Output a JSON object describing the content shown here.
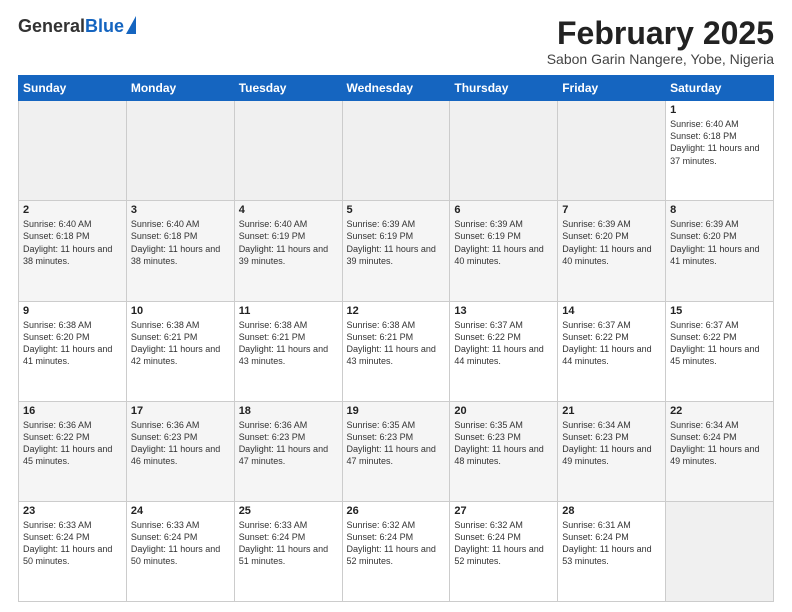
{
  "header": {
    "logo_general": "General",
    "logo_blue": "Blue",
    "month_title": "February 2025",
    "location": "Sabon Garin Nangere, Yobe, Nigeria"
  },
  "days_of_week": [
    "Sunday",
    "Monday",
    "Tuesday",
    "Wednesday",
    "Thursday",
    "Friday",
    "Saturday"
  ],
  "weeks": [
    [
      {
        "day": "",
        "empty": true
      },
      {
        "day": "",
        "empty": true
      },
      {
        "day": "",
        "empty": true
      },
      {
        "day": "",
        "empty": true
      },
      {
        "day": "",
        "empty": true
      },
      {
        "day": "",
        "empty": true
      },
      {
        "day": "1",
        "sunrise": "Sunrise: 6:40 AM",
        "sunset": "Sunset: 6:18 PM",
        "daylight": "Daylight: 11 hours and 37 minutes."
      }
    ],
    [
      {
        "day": "2",
        "sunrise": "Sunrise: 6:40 AM",
        "sunset": "Sunset: 6:18 PM",
        "daylight": "Daylight: 11 hours and 38 minutes."
      },
      {
        "day": "3",
        "sunrise": "Sunrise: 6:40 AM",
        "sunset": "Sunset: 6:18 PM",
        "daylight": "Daylight: 11 hours and 38 minutes."
      },
      {
        "day": "4",
        "sunrise": "Sunrise: 6:40 AM",
        "sunset": "Sunset: 6:19 PM",
        "daylight": "Daylight: 11 hours and 39 minutes."
      },
      {
        "day": "5",
        "sunrise": "Sunrise: 6:39 AM",
        "sunset": "Sunset: 6:19 PM",
        "daylight": "Daylight: 11 hours and 39 minutes."
      },
      {
        "day": "6",
        "sunrise": "Sunrise: 6:39 AM",
        "sunset": "Sunset: 6:19 PM",
        "daylight": "Daylight: 11 hours and 40 minutes."
      },
      {
        "day": "7",
        "sunrise": "Sunrise: 6:39 AM",
        "sunset": "Sunset: 6:20 PM",
        "daylight": "Daylight: 11 hours and 40 minutes."
      },
      {
        "day": "8",
        "sunrise": "Sunrise: 6:39 AM",
        "sunset": "Sunset: 6:20 PM",
        "daylight": "Daylight: 11 hours and 41 minutes."
      }
    ],
    [
      {
        "day": "9",
        "sunrise": "Sunrise: 6:38 AM",
        "sunset": "Sunset: 6:20 PM",
        "daylight": "Daylight: 11 hours and 41 minutes."
      },
      {
        "day": "10",
        "sunrise": "Sunrise: 6:38 AM",
        "sunset": "Sunset: 6:21 PM",
        "daylight": "Daylight: 11 hours and 42 minutes."
      },
      {
        "day": "11",
        "sunrise": "Sunrise: 6:38 AM",
        "sunset": "Sunset: 6:21 PM",
        "daylight": "Daylight: 11 hours and 43 minutes."
      },
      {
        "day": "12",
        "sunrise": "Sunrise: 6:38 AM",
        "sunset": "Sunset: 6:21 PM",
        "daylight": "Daylight: 11 hours and 43 minutes."
      },
      {
        "day": "13",
        "sunrise": "Sunrise: 6:37 AM",
        "sunset": "Sunset: 6:22 PM",
        "daylight": "Daylight: 11 hours and 44 minutes."
      },
      {
        "day": "14",
        "sunrise": "Sunrise: 6:37 AM",
        "sunset": "Sunset: 6:22 PM",
        "daylight": "Daylight: 11 hours and 44 minutes."
      },
      {
        "day": "15",
        "sunrise": "Sunrise: 6:37 AM",
        "sunset": "Sunset: 6:22 PM",
        "daylight": "Daylight: 11 hours and 45 minutes."
      }
    ],
    [
      {
        "day": "16",
        "sunrise": "Sunrise: 6:36 AM",
        "sunset": "Sunset: 6:22 PM",
        "daylight": "Daylight: 11 hours and 45 minutes."
      },
      {
        "day": "17",
        "sunrise": "Sunrise: 6:36 AM",
        "sunset": "Sunset: 6:23 PM",
        "daylight": "Daylight: 11 hours and 46 minutes."
      },
      {
        "day": "18",
        "sunrise": "Sunrise: 6:36 AM",
        "sunset": "Sunset: 6:23 PM",
        "daylight": "Daylight: 11 hours and 47 minutes."
      },
      {
        "day": "19",
        "sunrise": "Sunrise: 6:35 AM",
        "sunset": "Sunset: 6:23 PM",
        "daylight": "Daylight: 11 hours and 47 minutes."
      },
      {
        "day": "20",
        "sunrise": "Sunrise: 6:35 AM",
        "sunset": "Sunset: 6:23 PM",
        "daylight": "Daylight: 11 hours and 48 minutes."
      },
      {
        "day": "21",
        "sunrise": "Sunrise: 6:34 AM",
        "sunset": "Sunset: 6:23 PM",
        "daylight": "Daylight: 11 hours and 49 minutes."
      },
      {
        "day": "22",
        "sunrise": "Sunrise: 6:34 AM",
        "sunset": "Sunset: 6:24 PM",
        "daylight": "Daylight: 11 hours and 49 minutes."
      }
    ],
    [
      {
        "day": "23",
        "sunrise": "Sunrise: 6:33 AM",
        "sunset": "Sunset: 6:24 PM",
        "daylight": "Daylight: 11 hours and 50 minutes."
      },
      {
        "day": "24",
        "sunrise": "Sunrise: 6:33 AM",
        "sunset": "Sunset: 6:24 PM",
        "daylight": "Daylight: 11 hours and 50 minutes."
      },
      {
        "day": "25",
        "sunrise": "Sunrise: 6:33 AM",
        "sunset": "Sunset: 6:24 PM",
        "daylight": "Daylight: 11 hours and 51 minutes."
      },
      {
        "day": "26",
        "sunrise": "Sunrise: 6:32 AM",
        "sunset": "Sunset: 6:24 PM",
        "daylight": "Daylight: 11 hours and 52 minutes."
      },
      {
        "day": "27",
        "sunrise": "Sunrise: 6:32 AM",
        "sunset": "Sunset: 6:24 PM",
        "daylight": "Daylight: 11 hours and 52 minutes."
      },
      {
        "day": "28",
        "sunrise": "Sunrise: 6:31 AM",
        "sunset": "Sunset: 6:24 PM",
        "daylight": "Daylight: 11 hours and 53 minutes."
      },
      {
        "day": "",
        "empty": true
      }
    ]
  ]
}
